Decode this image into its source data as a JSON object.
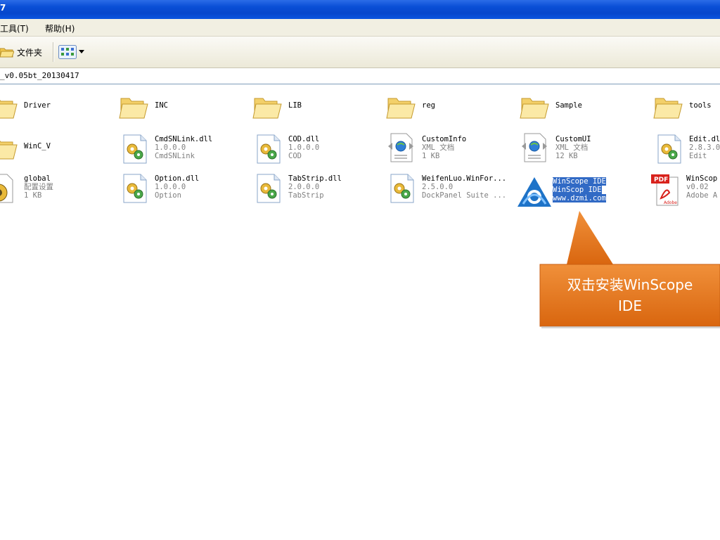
{
  "window": {
    "title": "7"
  },
  "menu": {
    "items": [
      "工具(T)",
      "帮助(H)"
    ]
  },
  "toolbar": {
    "folders_label": "文件夹"
  },
  "address": {
    "path": "_v0.05bt_20130417"
  },
  "items": [
    {
      "name": "Driver",
      "type": "folder"
    },
    {
      "name": "INC",
      "type": "folder"
    },
    {
      "name": "LIB",
      "type": "folder"
    },
    {
      "name": "reg",
      "type": "folder"
    },
    {
      "name": "Sample",
      "type": "folder"
    },
    {
      "name": "tools",
      "type": "folder"
    },
    {
      "name": "WinC_V",
      "type": "folder"
    },
    {
      "name": "CmdSNLink.dll",
      "line2": "1.0.0.0",
      "line3": "CmdSNLink",
      "type": "dll"
    },
    {
      "name": "COD.dll",
      "line2": "1.0.0.0",
      "line3": "COD",
      "type": "dll"
    },
    {
      "name": "CustomInfo",
      "line2": "XML 文档",
      "line3": "1 KB",
      "type": "xml"
    },
    {
      "name": "CustomUI",
      "line2": "XML 文档",
      "line3": "12 KB",
      "type": "xml"
    },
    {
      "name": "Edit.dl",
      "line2": "2.8.3.0",
      "line3": "Edit",
      "type": "dll"
    },
    {
      "name": "global",
      "line2": "配置设置",
      "line3": "1 KB",
      "type": "config"
    },
    {
      "name": "Option.dll",
      "line2": "1.0.0.0",
      "line3": "Option",
      "type": "dll"
    },
    {
      "name": "TabStrip.dll",
      "line2": "2.0.0.0",
      "line3": "TabStrip",
      "type": "dll"
    },
    {
      "name": "WeifenLuo.WinFor...",
      "line2": "2.5.0.0",
      "line3": "DockPanel Suite ...",
      "type": "dll"
    },
    {
      "name": "WinScope IDE",
      "line2": "WinScop IDE",
      "line3": "www.dzmi.com",
      "type": "app",
      "selected": true
    },
    {
      "name": "WinScop",
      "line2": "v0.02",
      "line3": "Adobe A",
      "type": "pdf"
    }
  ],
  "callout": {
    "line1": "双击安装WinScope",
    "line2": "IDE",
    "color": "#e8771a"
  },
  "icons": {
    "folder": "folder-icon",
    "dll": "dll-gear-icon",
    "xml": "xml-document-icon",
    "app": "winscope-logo-icon",
    "pdf": "pdf-icon",
    "config": "config-settings-icon",
    "views": "views-icon"
  }
}
